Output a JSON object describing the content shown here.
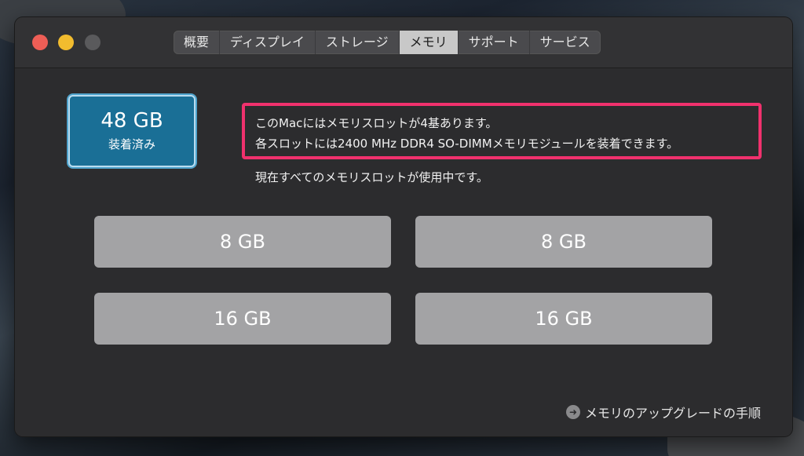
{
  "window": {
    "tabs": [
      {
        "label": "概要"
      },
      {
        "label": "ディスプレイ"
      },
      {
        "label": "ストレージ"
      },
      {
        "label": "メモリ",
        "active": true
      },
      {
        "label": "サポート"
      },
      {
        "label": "サービス"
      }
    ]
  },
  "memory": {
    "total_size": "48 GB",
    "total_label": "装着済み",
    "info_line1": "このMacにはメモリスロットが4基あります。",
    "info_line2": "各スロットには2400 MHz DDR4 SO-DIMMメモリモジュールを装着できます。",
    "info_line3": "現在すべてのメモリスロットが使用中です。",
    "slots": [
      "8 GB",
      "8 GB",
      "16 GB",
      "16 GB"
    ],
    "upgrade_link": "メモリのアップグレードの手順"
  },
  "colors": {
    "highlight_border": "#f0316d",
    "total_badge": "#1a6f96",
    "active_tab": "#c8c8c8"
  }
}
